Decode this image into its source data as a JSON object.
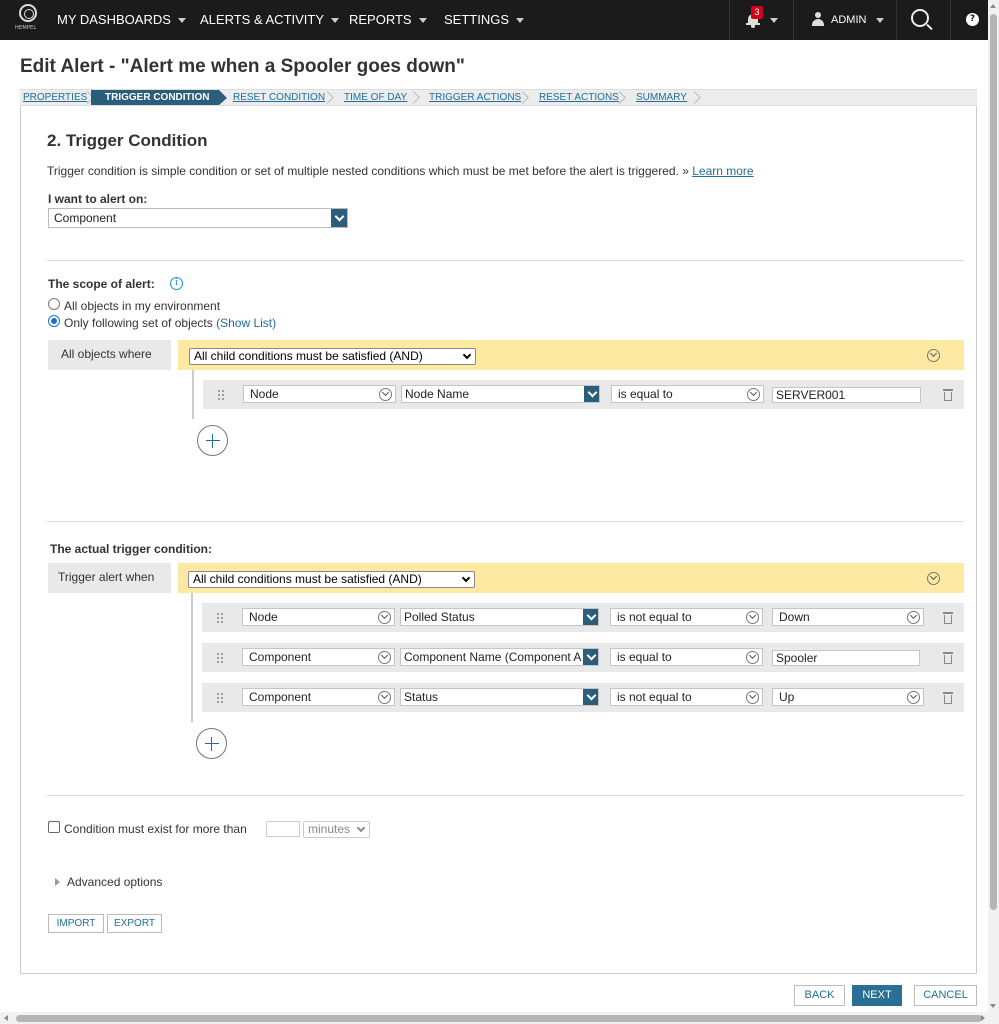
{
  "nav": {
    "logo_text": "HEMPEL",
    "items": [
      {
        "label": "MY DASHBOARDS"
      },
      {
        "label": "ALERTS & ACTIVITY"
      },
      {
        "label": "REPORTS"
      },
      {
        "label": "SETTINGS"
      }
    ],
    "notification_count": "3",
    "user_label": "ADMIN",
    "help_glyph": "?"
  },
  "page": {
    "title": "Edit Alert - \"Alert me when a Spooler goes down\""
  },
  "wizard": {
    "steps": [
      {
        "label": "PROPERTIES",
        "active": false
      },
      {
        "label": "TRIGGER CONDITION",
        "active": true
      },
      {
        "label": "RESET CONDITION",
        "active": false
      },
      {
        "label": "TIME OF DAY",
        "active": false
      },
      {
        "label": "TRIGGER ACTIONS",
        "active": false
      },
      {
        "label": "RESET ACTIONS",
        "active": false
      },
      {
        "label": "SUMMARY",
        "active": false
      }
    ]
  },
  "section": {
    "heading": "2. Trigger Condition",
    "description": "Trigger condition is simple condition or set of multiple nested conditions which must be met before the alert is triggered. »",
    "learn_more": "Learn more"
  },
  "alert_on": {
    "label": "I want to alert on:",
    "value": "Component"
  },
  "scope": {
    "label": "The scope of alert:",
    "info_glyph": "i",
    "option_all": "All objects in my environment",
    "option_following": "Only following set of objects",
    "show_list": "(Show List)",
    "selected": "following",
    "where_label": "All objects where",
    "group_mode": "All child conditions must be satisfied (AND)",
    "conditions": [
      {
        "object": "Node",
        "field": "Node Name",
        "operator": "is equal to",
        "value": "SERVER001",
        "value_type": "text"
      }
    ]
  },
  "trigger": {
    "label": "The actual trigger condition:",
    "where_label": "Trigger alert when",
    "group_mode": "All child conditions must be satisfied (AND)",
    "conditions": [
      {
        "object": "Node",
        "field": "Polled Status",
        "operator": "is not equal to",
        "value": "Down",
        "value_type": "select"
      },
      {
        "object": "Component",
        "field": "Component Name (Component A",
        "operator": "is equal to",
        "value": "Spooler",
        "value_type": "text"
      },
      {
        "object": "Component",
        "field": "Status",
        "operator": "is not equal to",
        "value": "Up",
        "value_type": "select"
      }
    ]
  },
  "duration": {
    "label": "Condition must exist for more than",
    "value": "",
    "unit": "minutes",
    "checked": false
  },
  "advanced": {
    "label": "Advanced options"
  },
  "io_buttons": {
    "import": "IMPORT",
    "export": "EXPORT"
  },
  "footer": {
    "back": "BACK",
    "next": "NEXT",
    "cancel": "CANCEL"
  },
  "colors": {
    "nav_bg": "#1b1b1b",
    "accent": "#2a5e7a",
    "link": "#1f6e99",
    "group_bar": "#fde9a2",
    "badge": "#d0021b"
  }
}
